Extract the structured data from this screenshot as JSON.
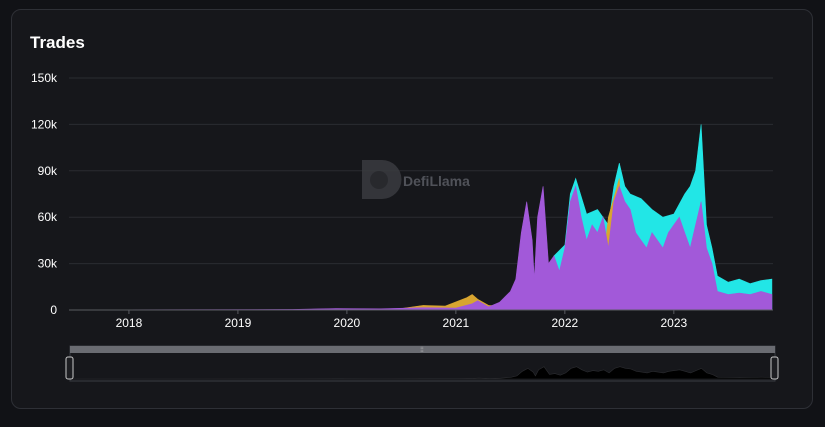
{
  "card": {
    "title": "Trades"
  },
  "watermark": {
    "text": "DefiLlama"
  },
  "colors": {
    "background": "#16171b",
    "grid": "#2a2c31",
    "primary": "#a259d9",
    "secondary": "#22e6e6",
    "tertiary": "#d8a530",
    "slider_track": "#6a6c72"
  },
  "chart_data": {
    "type": "area",
    "title": "Trades",
    "xlabel": "",
    "ylabel": "",
    "ylim": [
      0,
      150000
    ],
    "xlim": [
      2017.45,
      2023.91
    ],
    "grid": true,
    "y_ticks": [
      0,
      30000,
      60000,
      90000,
      120000,
      150000
    ],
    "y_tick_labels": [
      "0",
      "30k",
      "60k",
      "90k",
      "120k",
      "150k"
    ],
    "x_ticks": [
      2018,
      2019,
      2020,
      2021,
      2022,
      2023
    ],
    "x_tick_labels": [
      "2018",
      "2019",
      "2020",
      "2021",
      "2022",
      "2023"
    ],
    "series": [
      {
        "color": "#a259d9",
        "x": [
          2017.45,
          2018.5,
          2019.5,
          2019.9,
          2020.3,
          2020.7,
          2021.0,
          2021.15,
          2021.2,
          2021.3,
          2021.4,
          2021.5,
          2021.55,
          2021.6,
          2021.65,
          2021.7,
          2021.72,
          2021.75,
          2021.8,
          2021.85,
          2021.9,
          2021.95,
          2022.0,
          2022.05,
          2022.1,
          2022.15,
          2022.2,
          2022.25,
          2022.3,
          2022.35,
          2022.4,
          2022.45,
          2022.5,
          2022.55,
          2022.6,
          2022.65,
          2022.7,
          2022.75,
          2022.8,
          2022.85,
          2022.9,
          2022.95,
          2023.0,
          2023.05,
          2023.1,
          2023.15,
          2023.2,
          2023.25,
          2023.3,
          2023.35,
          2023.4,
          2023.5,
          2023.6,
          2023.7,
          2023.8,
          2023.9
        ],
        "y": [
          0,
          200,
          400,
          1000,
          800,
          1500,
          1200,
          4000,
          6000,
          2000,
          5000,
          12000,
          20000,
          50000,
          70000,
          45000,
          20000,
          60000,
          80000,
          30000,
          35000,
          25000,
          40000,
          70000,
          80000,
          60000,
          45000,
          55000,
          50000,
          60000,
          40000,
          70000,
          80000,
          70000,
          65000,
          50000,
          45000,
          40000,
          50000,
          45000,
          40000,
          50000,
          55000,
          60000,
          50000,
          40000,
          55000,
          70000,
          40000,
          30000,
          12000,
          10000,
          11000,
          10000,
          12000,
          10000
        ]
      },
      {
        "color": "#22e6e6",
        "x": [
          2021.9,
          2022.0,
          2022.05,
          2022.1,
          2022.2,
          2022.3,
          2022.4,
          2022.45,
          2022.5,
          2022.55,
          2022.6,
          2022.7,
          2022.8,
          2022.9,
          2023.0,
          2023.1,
          2023.15,
          2023.2,
          2023.25,
          2023.3,
          2023.35,
          2023.4,
          2023.5,
          2023.6,
          2023.7,
          2023.8,
          2023.9
        ],
        "y": [
          35000,
          42000,
          75000,
          85000,
          62000,
          65000,
          55000,
          80000,
          95000,
          80000,
          75000,
          72000,
          65000,
          60000,
          62000,
          75000,
          80000,
          90000,
          120000,
          55000,
          40000,
          22000,
          18000,
          20000,
          17000,
          19000,
          20000
        ]
      },
      {
        "color": "#d8a530",
        "x": [
          2020.5,
          2020.7,
          2020.9,
          2021.1,
          2021.15,
          2021.2,
          2021.3,
          2022.3,
          2022.4,
          2022.5,
          2022.55
        ],
        "y": [
          1000,
          3000,
          2500,
          8000,
          10000,
          7000,
          3000,
          0,
          60000,
          85000,
          0
        ]
      }
    ]
  }
}
